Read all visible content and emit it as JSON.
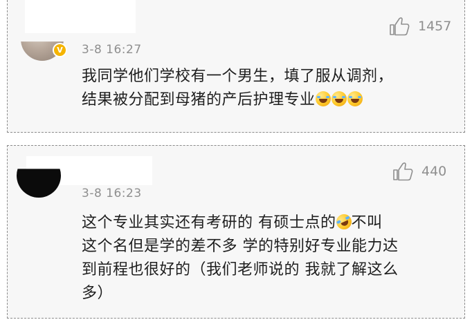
{
  "comments": [
    {
      "timestamp": "3-8 16:27",
      "likes": "1457",
      "verified_badge": "V",
      "lines": [
        "我同学他们学校有一个男生，填了服从调剂，",
        "结果被分配到母猪的产后护理专业"
      ],
      "trailing_emojis": [
        "laugh-cry-emoji",
        "laugh-cry-emoji",
        "laugh-cry-emoji"
      ]
    },
    {
      "timestamp": "3-8 16:23",
      "likes": "440",
      "line1_before_emoji": "这个专业其实还有考研的  有硕士点的",
      "line1_emoji": "rolling-laugh-emoji",
      "line1_after_emoji": "不叫",
      "lines_rest": [
        "这个名但是学的差不多 学的特别好专业能力达",
        "到前程也很好的（我们老师说的 我就了解这么",
        "多）"
      ]
    }
  ],
  "icons": {
    "like": "thumbs-up-outline-icon",
    "verified": "verified-badge-icon"
  },
  "colors": {
    "card_background": "#f7f7f7",
    "meta_text": "#8f8f8f",
    "body_text": "#1e1e1e",
    "badge": "#f5b400"
  }
}
